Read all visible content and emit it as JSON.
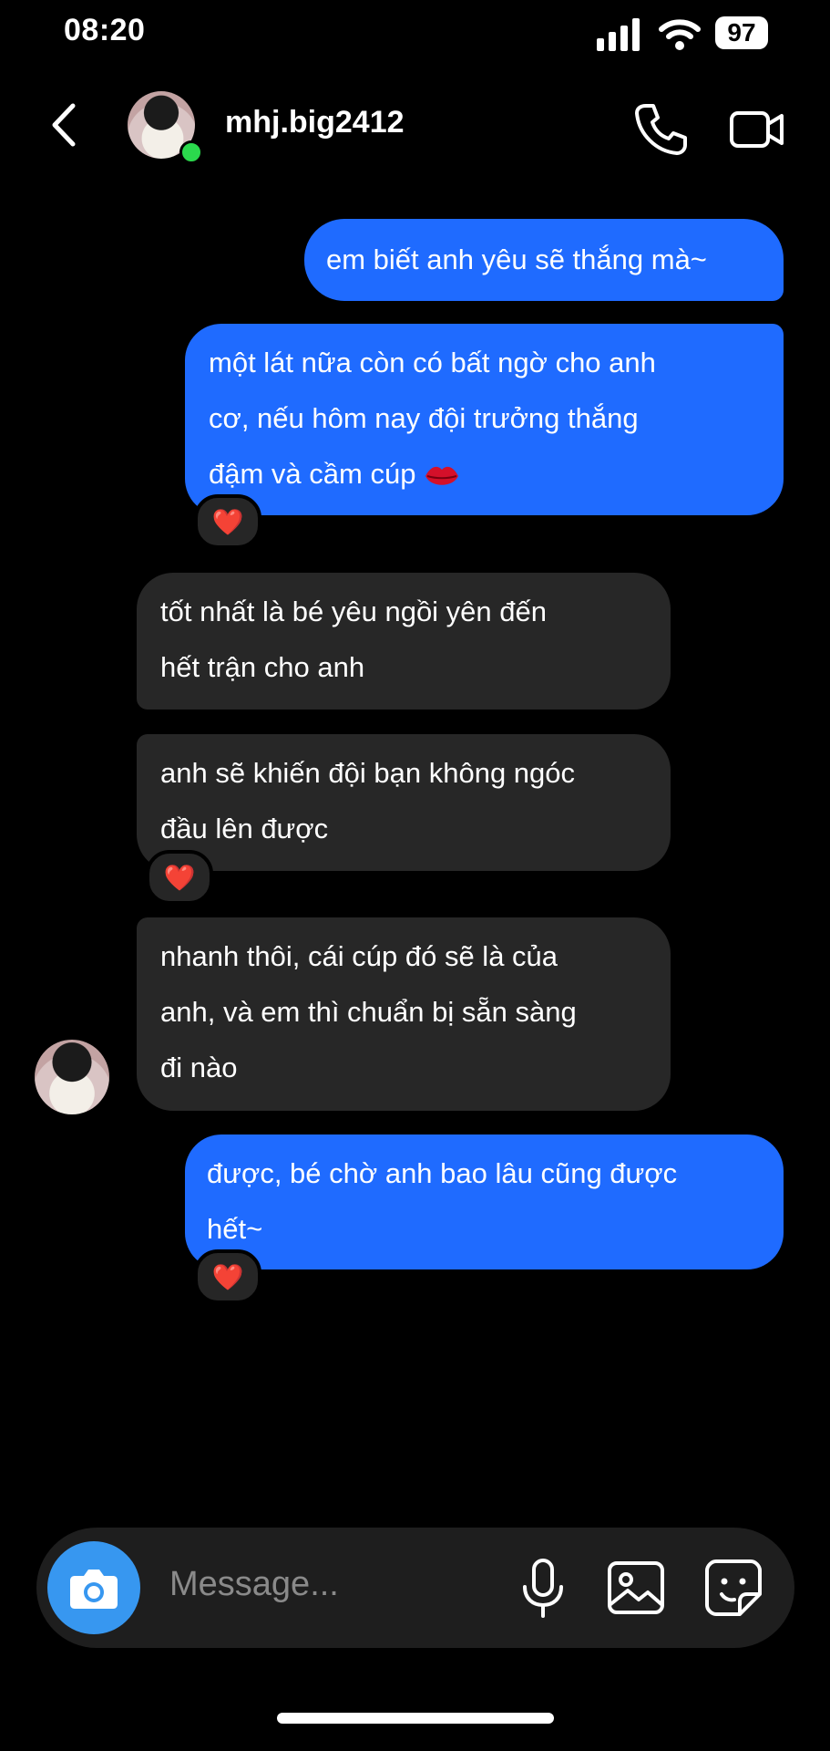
{
  "status_bar": {
    "time": "08:20",
    "battery": "97"
  },
  "header": {
    "username": "mhj.big2412"
  },
  "messages": [
    {
      "side": "outgoing",
      "text": "em biết anh yêu sẽ thắng mà~"
    },
    {
      "side": "outgoing",
      "line1": "một lát nữa còn có bất ngờ cho anh",
      "line2": "cơ, nếu hôm nay đội trưởng thắng",
      "line3": "đậm và cầm cúp",
      "emoji": "lips-icon",
      "reaction": "❤️"
    },
    {
      "side": "incoming",
      "line1": "tốt nhất là bé yêu ngồi yên đến",
      "line2": "hết trận cho anh"
    },
    {
      "side": "incoming",
      "line1": "anh sẽ khiến đội bạn không ngóc",
      "line2": "đầu lên được",
      "reaction": "❤️"
    },
    {
      "side": "incoming",
      "line1": "nhanh thôi, cái cúp đó sẽ là của",
      "line2": "anh, và em thì chuẩn bị sẵn sàng",
      "line3": "đi nào"
    },
    {
      "side": "outgoing",
      "line1": "được, bé chờ anh bao lâu cũng được",
      "line2": "hết~",
      "reaction": "❤️"
    }
  ],
  "composer": {
    "placeholder": "Message..."
  },
  "colors": {
    "outgoing_bubble": "#1f6bff",
    "incoming_bubble": "#272727",
    "online": "#2bd94d",
    "camera": "#3797f0"
  }
}
